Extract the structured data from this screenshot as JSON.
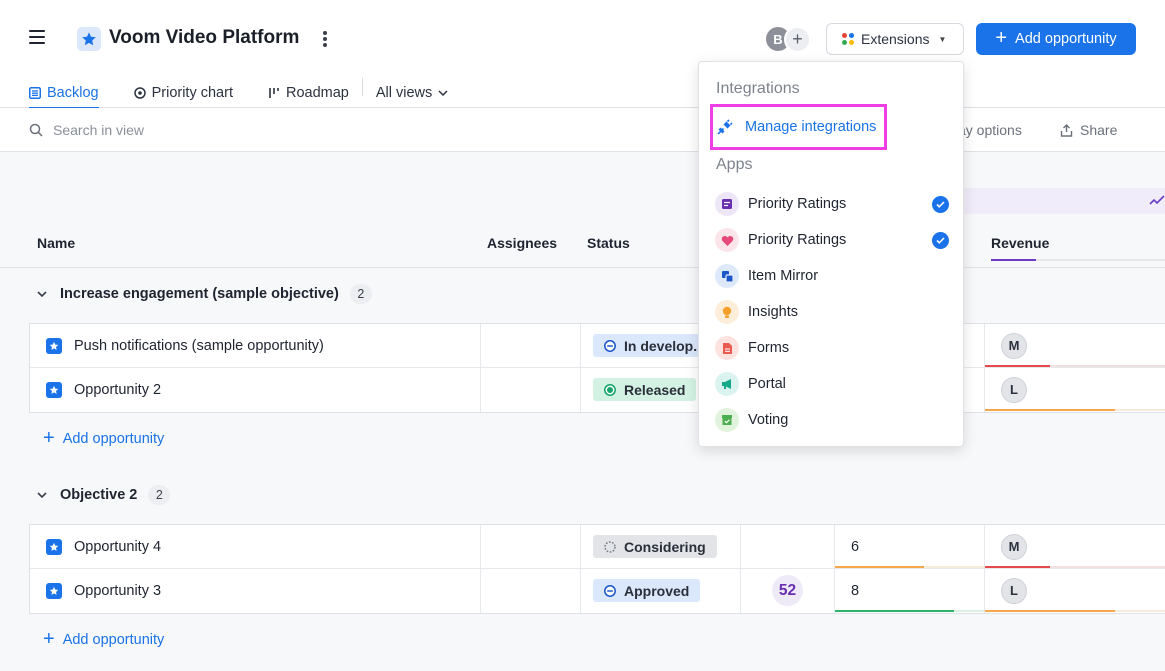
{
  "app": {
    "title": "Voom Video Platform",
    "avatar_initial": "B",
    "add_member_symbol": "+"
  },
  "header": {
    "extensions_label": "Extensions",
    "add_opportunity_label": "Add opportunity"
  },
  "tabs": [
    {
      "label": "Backlog",
      "icon": "list-icon",
      "active": true
    },
    {
      "label": "Priority chart",
      "icon": "target-icon",
      "active": false
    },
    {
      "label": "Roadmap",
      "icon": "roadmap-icon",
      "active": false
    },
    {
      "label": "All views",
      "icon": "chevron-down-icon",
      "active": false
    }
  ],
  "toolbar": {
    "search_placeholder": "Search in view",
    "display_options_label": "ay options",
    "share_label": "Share"
  },
  "columns": {
    "name": "Name",
    "assignees": "Assignees",
    "status": "Status",
    "revenue": "Revenue"
  },
  "groups": [
    {
      "name": "Increase engagement (sample objective)",
      "count": "2",
      "add_label": "Add opportunity",
      "rows": [
        {
          "name": "Push notifications (sample opportunity)",
          "status": "In develop.",
          "status_color": "#dbe7fb",
          "score": "",
          "value": "",
          "owner": "M",
          "owner_bar_color": "#e5484d",
          "owner_bar_fraction": 0.5
        },
        {
          "name": "Opportunity 2",
          "status": "Released",
          "status_color": "#d3f2e3",
          "score": "",
          "value": "",
          "owner": "L",
          "owner_bar_color": "#f5a74b",
          "owner_bar_fraction": 1.0
        }
      ]
    },
    {
      "name": "Objective 2",
      "count": "2",
      "add_label": "Add opportunity",
      "rows": [
        {
          "name": "Opportunity 4",
          "status": "Considering",
          "status_color": "#e2e4e8",
          "score": "",
          "value": "6",
          "value_bar_color": "#f5a74b",
          "value_bar_fraction": 0.6,
          "owner": "M",
          "owner_bar_color": "#e5484d",
          "owner_bar_fraction": 0.5
        },
        {
          "name": "Opportunity 3",
          "status": "Approved",
          "status_color": "#dbe7fb",
          "score": "52",
          "value": "8",
          "value_bar_color": "#2fb36a",
          "value_bar_fraction": 0.8,
          "owner": "L",
          "owner_bar_color": "#f5a74b",
          "owner_bar_fraction": 1.0
        }
      ]
    }
  ],
  "dropdown": {
    "integrations_heading": "Integrations",
    "manage_label": "Manage integrations",
    "apps_heading": "Apps",
    "apps": [
      {
        "label": "Priority Ratings",
        "icon": "priority-ratings-icon",
        "bg": "#ece6f6",
        "fg": "#6a2fb0",
        "checked": true
      },
      {
        "label": "Priority Ratings",
        "icon": "heart-sparkle-icon",
        "bg": "#fbe4ea",
        "fg": "#e5487a",
        "checked": true
      },
      {
        "label": "Item Mirror",
        "icon": "mirror-icon",
        "bg": "#dde8fb",
        "fg": "#1a56c8",
        "checked": false
      },
      {
        "label": "Insights",
        "icon": "lightbulb-icon",
        "bg": "#fdeed9",
        "fg": "#f5a02a",
        "checked": false
      },
      {
        "label": "Forms",
        "icon": "form-icon",
        "bg": "#fde2e0",
        "fg": "#ea5a4f",
        "checked": false
      },
      {
        "label": "Portal",
        "icon": "megaphone-icon",
        "bg": "#daf3ee",
        "fg": "#15a98a",
        "checked": false
      },
      {
        "label": "Voting",
        "icon": "ballot-box-icon",
        "bg": "#e1f3dd",
        "fg": "#4caf50",
        "checked": false
      }
    ]
  },
  "colors": {
    "accent": "#1a73e8",
    "highlight_border": "#ee3fe6",
    "revenue_accent": "#6a3dc4"
  }
}
